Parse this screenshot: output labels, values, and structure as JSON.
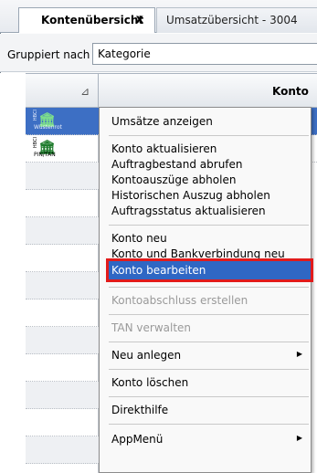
{
  "tabs": [
    {
      "label": "Kontenübersicht",
      "active": true
    },
    {
      "label": "Umsatzübersicht - 3004",
      "active": false
    }
  ],
  "tab_close_glyph": "x",
  "groupbar": {
    "label": "Gruppiert nach",
    "value": "Kategorie"
  },
  "grid": {
    "column_header": "Konto",
    "rows": [
      {
        "type_label": "HBCI",
        "sub_label": "Wüstenrot",
        "selected": true
      },
      {
        "type_label": "HBCI",
        "sub_label": "PIN/TAN",
        "selected": false
      }
    ]
  },
  "menu": {
    "items": [
      {
        "label": "Umsätze anzeigen",
        "enabled": true
      },
      {
        "label": "Konto aktualisieren",
        "enabled": true
      },
      {
        "label": "Auftragbestand abrufen",
        "enabled": true
      },
      {
        "label": "Kontoauszüge abholen",
        "enabled": true
      },
      {
        "label": "Historischen Auszug abholen",
        "enabled": true
      },
      {
        "label": "Auftragsstatus aktualisieren",
        "enabled": true
      },
      {
        "label": "Konto neu",
        "enabled": true
      },
      {
        "label": "Konto und Bankverbindung neu",
        "enabled": true
      },
      {
        "label": "Konto bearbeiten",
        "enabled": true,
        "highlighted": true
      },
      {
        "label": "Kontoabschluss erstellen",
        "enabled": false
      },
      {
        "label": "TAN verwalten",
        "enabled": false
      },
      {
        "label": "Neu anlegen",
        "enabled": true,
        "submenu": true
      },
      {
        "label": "Konto löschen",
        "enabled": true
      },
      {
        "label": "Direkthilfe",
        "enabled": true
      },
      {
        "label": "AppMenü",
        "enabled": true,
        "submenu": true
      }
    ]
  },
  "colors": {
    "selection": "#2f67c4",
    "highlight_outline": "#e21b1b",
    "bank_icon": "#1c7a2a"
  },
  "icons": [
    "close-icon",
    "sort-icon",
    "bank-icon",
    "submenu-arrow-icon"
  ]
}
